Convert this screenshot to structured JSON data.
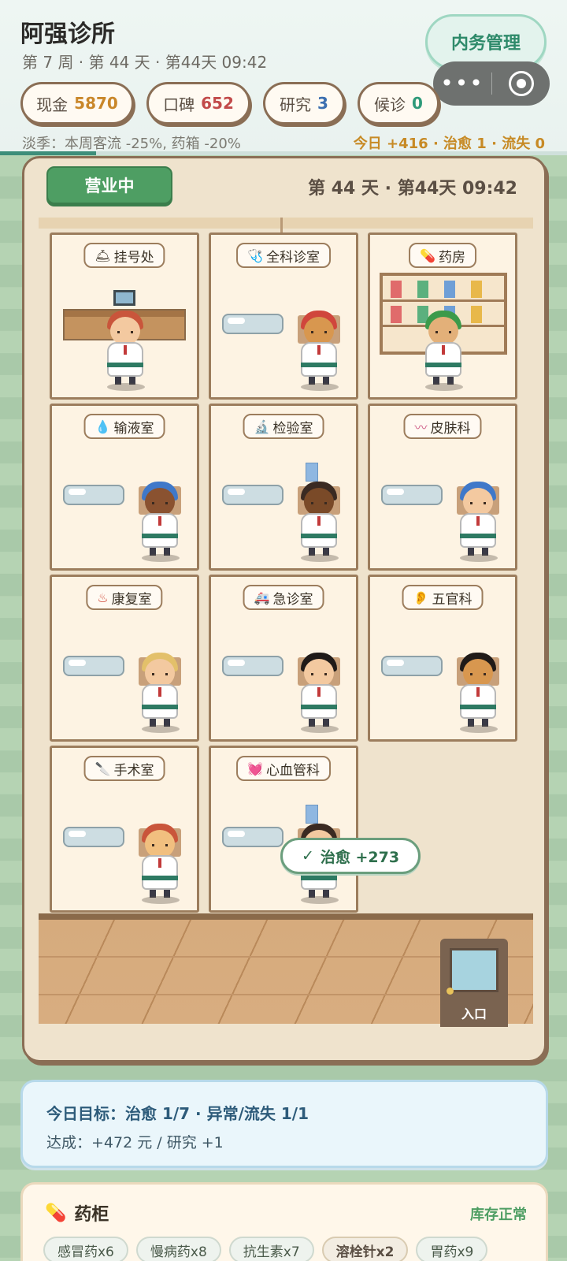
{
  "header": {
    "title": "阿强诊所",
    "subtitle": "第 7 周 · 第 44 天 · 第44天 09:42",
    "admin_button": "内务管理",
    "capsule_dots": "•••",
    "stats": [
      {
        "label": "现金",
        "value": "5870",
        "color": "#c9872a"
      },
      {
        "label": "口碑",
        "value": "652",
        "color": "#c24a4a"
      },
      {
        "label": "研究",
        "value": "3",
        "color": "#3c6fb0"
      },
      {
        "label": "候诊",
        "value": "0",
        "color": "#2e9a7a"
      }
    ],
    "notice": "淡季：本周客流 -25%, 药箱 -20%",
    "today": "今日 +416 · 治愈 1 · 流失 0",
    "day_progress": 0.17
  },
  "board": {
    "status_button": "营业中",
    "day_label": "第 44 天 · 第44天 09:42",
    "rooms": [
      {
        "name": "挂号处",
        "icon": "🛎"
      },
      {
        "name": "全科诊室",
        "icon": "🩺"
      },
      {
        "name": "药房",
        "icon": "💊"
      },
      {
        "name": "输液室",
        "icon": "💧"
      },
      {
        "name": "检验室",
        "icon": "🔬"
      },
      {
        "name": "皮肤科",
        "icon": "〰"
      },
      {
        "name": "康复室",
        "icon": "♨"
      },
      {
        "name": "急诊室",
        "icon": "🚑"
      },
      {
        "name": "五官科",
        "icon": "👂"
      },
      {
        "name": "手术室",
        "icon": "🔪"
      },
      {
        "name": "心血管科",
        "icon": "💓"
      }
    ],
    "entrance": "入口",
    "toast": "治愈 +273",
    "toast_icon": "✓"
  },
  "goal": {
    "line1": "今日目标：治愈 1/7 · 异常/流失 1/1",
    "line2": "达成：+472 元 / 研究 +1"
  },
  "medicine": {
    "title": "药柜",
    "icon": "💊",
    "status": "库存正常",
    "items": [
      "感冒药x6",
      "慢病药x8",
      "抗生素x7",
      "溶栓针x2",
      "胃药x9"
    ]
  },
  "colors": {
    "accent_green": "#4e9e63",
    "board_bg": "#efe3cd",
    "border_brown": "#8a6e55"
  }
}
